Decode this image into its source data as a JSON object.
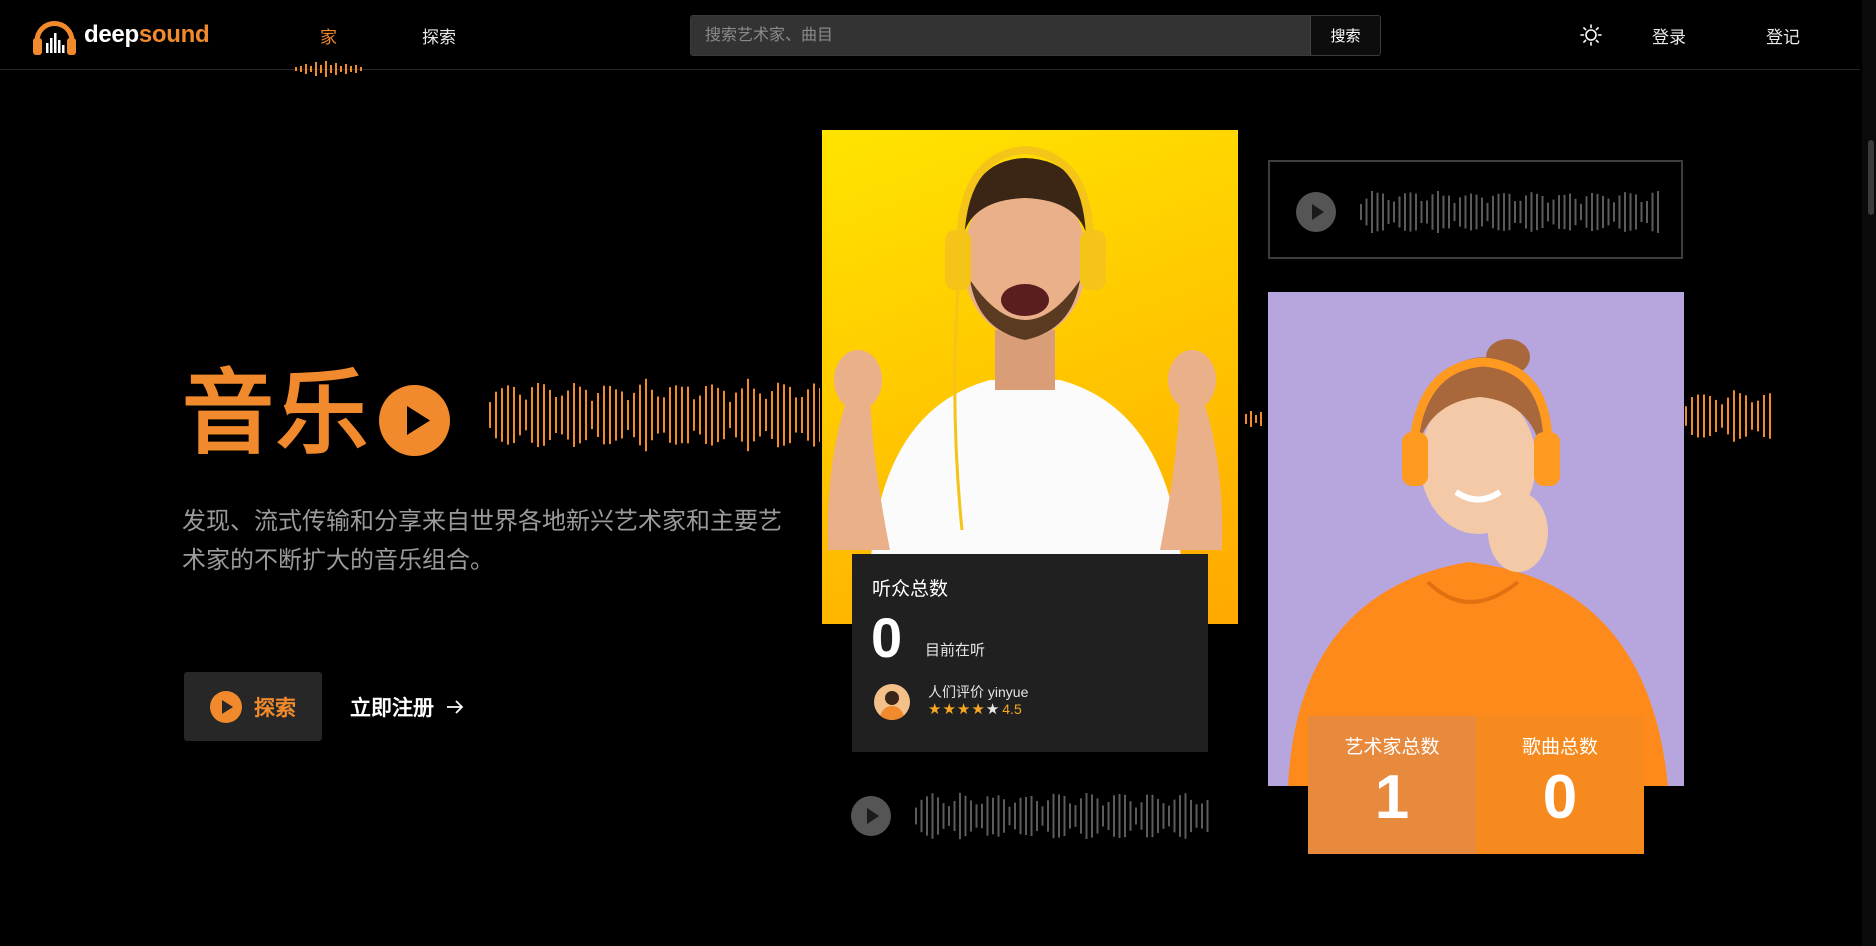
{
  "brand": {
    "name_part1": "deep",
    "name_part2": "sound",
    "accent": "#f08a2c"
  },
  "nav": {
    "home": "家",
    "explore": "探索",
    "search_placeholder": "搜索艺术家、曲目",
    "search_button": "搜索",
    "theme_icon": "sun-icon",
    "login": "登录",
    "register": "登记"
  },
  "hero": {
    "title": "音乐",
    "description": "发现、流式传输和分享来自世界各地新兴艺术家和主要艺术家的不断扩大的音乐组合。",
    "explore_button": "探索",
    "signup_link": "立即注册"
  },
  "listeners_card": {
    "title": "听众总数",
    "count": "0",
    "subtitle": "目前在听",
    "rated_by": "人们评价 yinyue",
    "rating": "4.5",
    "stars": 4.5
  },
  "stats": {
    "artists_label": "艺术家总数",
    "artists_count": "1",
    "songs_label": "歌曲总数",
    "songs_count": "0"
  }
}
